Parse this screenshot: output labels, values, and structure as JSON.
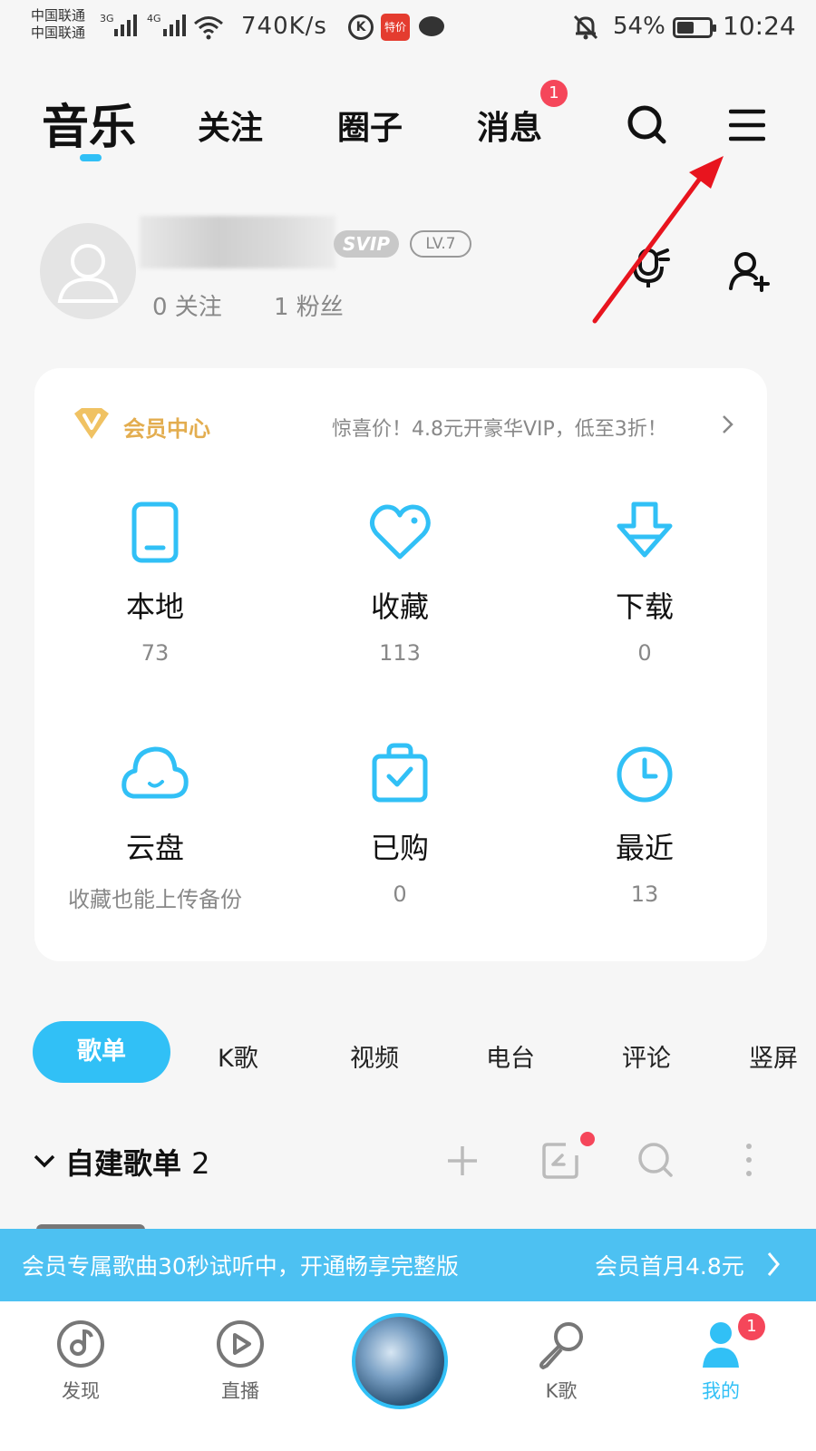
{
  "status_bar": {
    "carrier_1": "中国联通",
    "carrier_2": "中国联通",
    "net_1": "3G",
    "net_2": "4G",
    "speed": "740K/s",
    "k_icon": "K",
    "tejia_icon": "特价",
    "battery_percent": "54%",
    "battery_level": 0.54,
    "time": "10:24"
  },
  "top_nav": {
    "tabs": [
      "音乐",
      "关注",
      "圈子",
      "消息"
    ],
    "messages_badge": "1"
  },
  "profile": {
    "svip_badge": "SVIP",
    "level_badge": "LV.7",
    "following": "0 关注",
    "fans": "1 粉丝"
  },
  "vip_center": {
    "title": "会员中心",
    "promo": "惊喜价！4.8元开豪华VIP，低至3折！"
  },
  "grid": [
    {
      "label": "本地",
      "sub": "73",
      "icon": "phone-icon"
    },
    {
      "label": "收藏",
      "sub": "113",
      "icon": "heart-icon"
    },
    {
      "label": "下载",
      "sub": "0",
      "icon": "download-icon"
    },
    {
      "label": "云盘",
      "sub": "收藏也能上传备份",
      "icon": "cloud-icon"
    },
    {
      "label": "已购",
      "sub": "0",
      "icon": "purchased-bag-icon"
    },
    {
      "label": "最近",
      "sub": "13",
      "icon": "clock-icon"
    }
  ],
  "content_tabs": [
    "歌单",
    "K歌",
    "视频",
    "电台",
    "评论",
    "竖屏"
  ],
  "playlist_section": {
    "title": "自建歌单",
    "count": "2"
  },
  "banner": {
    "text": "会员专属歌曲30秒试听中，开通畅享完整版",
    "cta": "会员首月4.8元"
  },
  "bottom_nav": {
    "items": [
      "发现",
      "直播",
      "K歌",
      "我的"
    ],
    "me_badge": "1"
  },
  "colors": {
    "accent": "#31c0f6",
    "badge": "#f5465a",
    "vip_gold": "#e3ad4f",
    "annotation_arrow": "#e8141e"
  }
}
